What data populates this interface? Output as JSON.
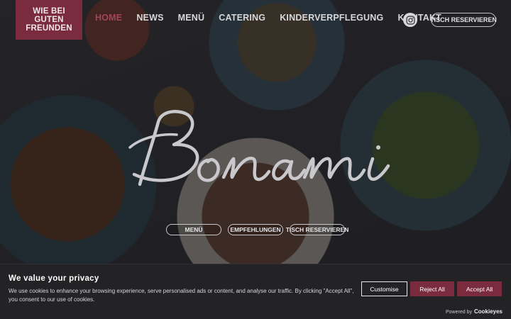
{
  "header": {
    "logo_lines": [
      "WIE BEI",
      "GUTEN",
      "FREUNDEN"
    ],
    "nav": [
      {
        "label": "HOME",
        "active": true
      },
      {
        "label": "NEWS",
        "active": false
      },
      {
        "label": "MENÜ",
        "active": false
      },
      {
        "label": "CATERING",
        "active": false
      },
      {
        "label": "KINDERVERPFLEGUNG",
        "active": false
      },
      {
        "label": "KONTAKT",
        "active": false
      }
    ],
    "instagram_icon": "instagram-icon",
    "cta_label": "TISCH RESERVIEREN"
  },
  "hero": {
    "wordmark": "Bonami",
    "buttons": [
      "MENÜ",
      "EMPFEHLUNGEN",
      "TISCH RESERVIEREN"
    ]
  },
  "cookie_banner": {
    "title": "We value your privacy",
    "text": "We use cookies to enhance your browsing experience, serve personalised ads or content, and analyse our traffic. By clicking \"Accept All\", you consent to our use of cookies.",
    "customise_label": "Customise",
    "reject_label": "Reject All",
    "accept_label": "Accept All",
    "powered_by": "Powered by",
    "powered_brand": "Cookieyes"
  },
  "colors": {
    "accent": "#7a2b3e",
    "active_nav": "#a3455b"
  }
}
